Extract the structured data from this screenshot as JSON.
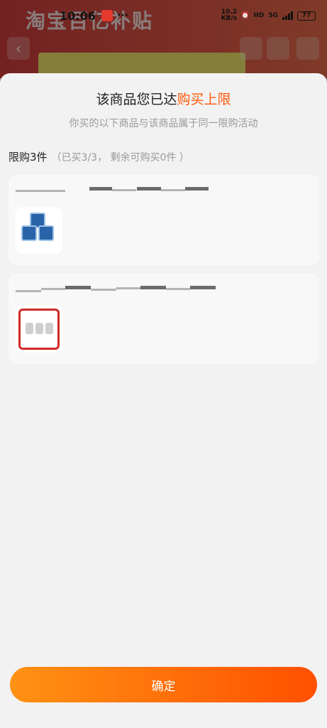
{
  "status_bar": {
    "time": "10:06",
    "more": "···",
    "net_speed_top": "10.2",
    "net_speed_bottom": "KB/s",
    "network": "5G",
    "battery": "77"
  },
  "background": {
    "banner_text": "淘宝百亿补贴"
  },
  "sheet": {
    "title_prefix": "该商品您已达",
    "title_highlight": "购买上限",
    "subtitle": "你买的以下商品与该商品属于同一限购活动",
    "limit_label": "限购3件",
    "limit_detail": "（已买3/3，  剩余可购买0件 ）",
    "confirm_label": "确定"
  },
  "products": [
    {
      "icon": "paper-towel-product-image"
    },
    {
      "icon": "appliance-product-image"
    }
  ],
  "colors": {
    "accent": "#ff5a0a",
    "button_start": "#ff9214",
    "button_end": "#ff5000"
  }
}
